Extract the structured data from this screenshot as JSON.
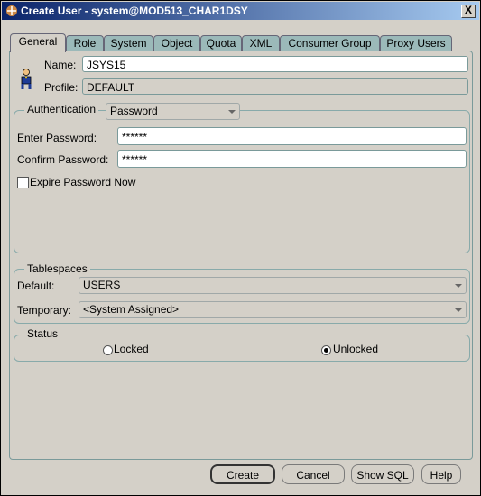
{
  "window": {
    "title": "Create User - system@MOD513_CHAR1DSY",
    "close_label": "X"
  },
  "tabs": [
    "General",
    "Role",
    "System",
    "Object",
    "Quota",
    "XML",
    "Consumer Group",
    "Proxy Users"
  ],
  "general": {
    "name_label": "Name:",
    "name_value": "JSYS15",
    "profile_label": "Profile:",
    "profile_value": "DEFAULT"
  },
  "authentication": {
    "legend": "Authentication",
    "type_value": "Password",
    "enter_password_label": "Enter Password:",
    "enter_password_value": "******",
    "confirm_password_label": "Confirm Password:",
    "confirm_password_value": "******",
    "expire_label": "Expire Password Now",
    "expire_checked": false
  },
  "tablespaces": {
    "legend": "Tablespaces",
    "default_label": "Default:",
    "default_value": "USERS",
    "temporary_label": "Temporary:",
    "temporary_value": "<System Assigned>"
  },
  "status": {
    "legend": "Status",
    "locked_label": "Locked",
    "unlocked_label": "Unlocked",
    "selected": "Unlocked"
  },
  "buttons": {
    "create": "Create",
    "cancel": "Cancel",
    "show_sql": "Show SQL",
    "help": "Help"
  }
}
